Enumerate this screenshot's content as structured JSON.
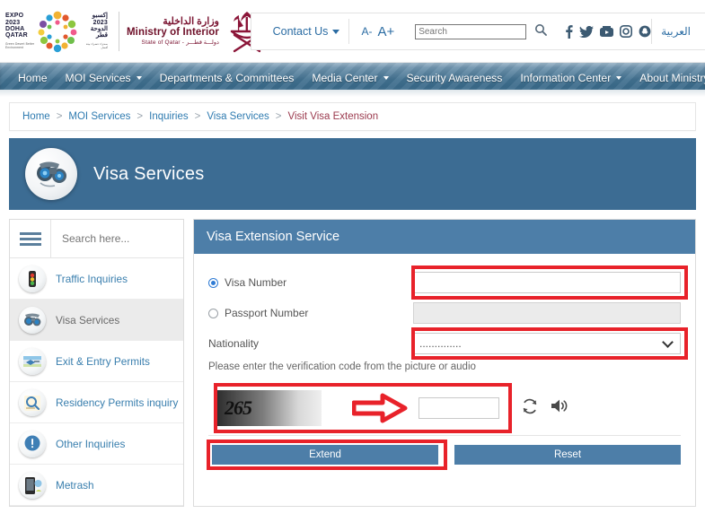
{
  "header": {
    "expo_logo": {
      "en_line1": "EXPO",
      "en_line2": "2023",
      "en_line3": "DOHA",
      "en_line4": "QATAR",
      "en_sub": "Green Desert\nBetter Environment",
      "ar_line1": "إكسبو",
      "ar_line2": "2023",
      "ar_line3": "الدوحة",
      "ar_line4": "قطر",
      "ar_sub": "صحراء خضراء\nبيئة أفضل"
    },
    "ministry": {
      "name_ar": "وزارة الداخلية",
      "name_en": "Ministry of Interior",
      "state_en": "State of Qatar -",
      "state_ar": "دولـــة قطـــر"
    },
    "contact_us": "Contact Us",
    "font_smaller": "A-",
    "font_larger": "A+",
    "search_placeholder": "Search",
    "search_value": "",
    "social": [
      "facebook-icon",
      "twitter-icon",
      "youtube-icon",
      "instagram-icon",
      "snapchat-icon"
    ],
    "language_link": "العربية"
  },
  "nav": {
    "items": [
      {
        "label": "Home",
        "has_caret": false
      },
      {
        "label": "MOI Services",
        "has_caret": true
      },
      {
        "label": "Departments & Committees",
        "has_caret": false
      },
      {
        "label": "Media Center",
        "has_caret": true
      },
      {
        "label": "Security Awareness",
        "has_caret": false
      },
      {
        "label": "Information Center",
        "has_caret": true
      },
      {
        "label": "About Ministry",
        "has_caret": true
      }
    ]
  },
  "breadcrumb": {
    "items": [
      "Home",
      "MOI Services",
      "Inquiries",
      "Visa Services"
    ],
    "current": "Visit Visa Extension",
    "separator": ">"
  },
  "banner": {
    "title": "Visa Services",
    "icon": "visa-services-icon"
  },
  "sidebar": {
    "menu_icon": "hamburger-icon",
    "search_placeholder": "Search here...",
    "search_value": "",
    "items": [
      {
        "label": "Traffic Inquiries",
        "icon": "traffic-light-icon",
        "active": false
      },
      {
        "label": "Visa Services",
        "icon": "visa-services-icon",
        "active": true
      },
      {
        "label": "Exit & Entry Permits",
        "icon": "exit-entry-icon",
        "active": false
      },
      {
        "label": "Residency Permits inquiry",
        "icon": "residency-icon",
        "active": false
      },
      {
        "label": "Other Inquiries",
        "icon": "info-exclamation-icon",
        "active": false
      },
      {
        "label": "Metrash",
        "icon": "metrash-phone-icon",
        "active": false
      }
    ]
  },
  "form": {
    "panel_title": "Visa Extension Service",
    "visa_number_label": "Visa Number",
    "visa_number_value": "",
    "visa_number_selected": true,
    "passport_number_label": "Passport Number",
    "passport_number_value": "",
    "passport_number_selected": false,
    "nationality_label": "Nationality",
    "nationality_value": "..............",
    "captcha_hint": "Please enter the verification code from the picture or audio",
    "captcha_text": "265",
    "captcha_input_value": "",
    "refresh_icon": "refresh-icon",
    "audio_icon": "speaker-icon",
    "extend_button": "Extend",
    "reset_button": "Reset"
  },
  "annotations": {
    "highlight_color": "#e8222a",
    "arrow_icon": "right-arrow-annotation"
  }
}
